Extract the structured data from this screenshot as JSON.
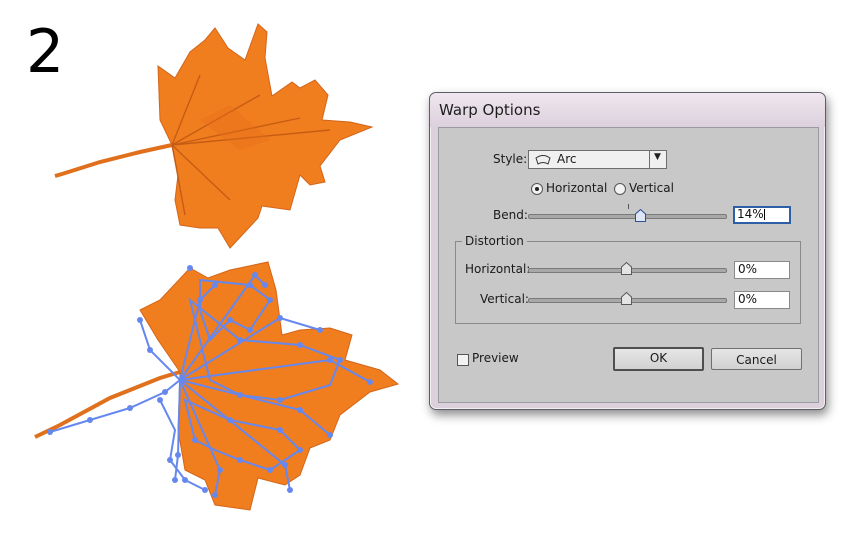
{
  "step": {
    "number": "2"
  },
  "dialog": {
    "title": "Warp Options",
    "style": {
      "label": "Style:",
      "value": "Arc",
      "icon": "arc-warp-icon"
    },
    "orientation": {
      "horizontal_label": "Horizontal",
      "vertical_label": "Vertical",
      "selected": "Horizontal"
    },
    "bend": {
      "label": "Bend:",
      "value": "14%",
      "level_percent": 14
    },
    "distortion": {
      "title": "Distortion",
      "horizontal": {
        "label": "Horizontal:",
        "value": "0%",
        "level_percent": 0
      },
      "vertical": {
        "label": "Vertical:",
        "value": "0%",
        "level_percent": 0
      }
    },
    "preview": {
      "label": "Preview",
      "checked": false
    },
    "buttons": {
      "ok": "OK",
      "cancel": "Cancel"
    }
  },
  "colors": {
    "leaf": "#f07d1e",
    "leaf_dark": "#cf5c14",
    "path_overlay": "#6688ee",
    "focus_border": "#2c5fa8"
  }
}
